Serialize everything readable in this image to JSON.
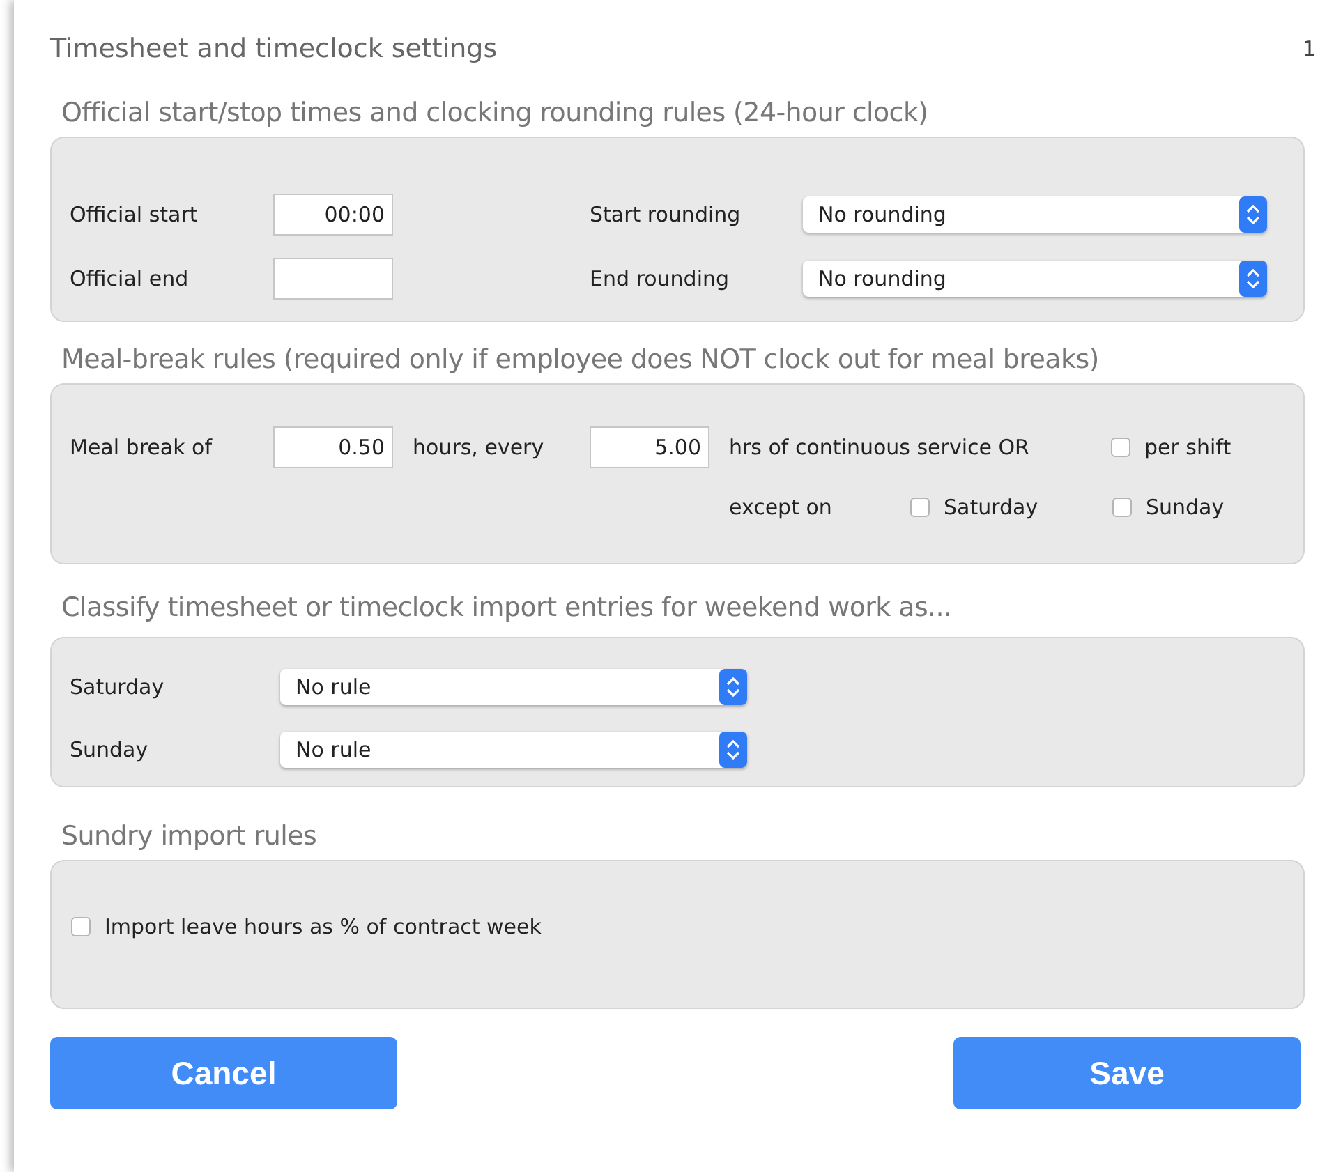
{
  "window": {
    "title": "Timesheet and timeclock settings",
    "page_number": "1"
  },
  "official_times": {
    "heading": "Official start/stop times and clocking rounding rules (24-hour clock)",
    "rows": [
      {
        "label": "Official start",
        "value": "00:00",
        "rounding_label": "Start rounding",
        "rounding_value": "No rounding"
      },
      {
        "label": "Official end",
        "value": "",
        "rounding_label": "End rounding",
        "rounding_value": "No rounding"
      }
    ]
  },
  "meal_break": {
    "heading": "Meal-break rules (required only if employee does NOT clock out for meal breaks)",
    "label": "Meal break of",
    "hours_value": "0.50",
    "hours_label": "hours, every",
    "every_value": "5.00",
    "service_label": "hrs of continuous service OR",
    "per_shift": {
      "label": "per shift",
      "checked": false
    },
    "except_label": "except on",
    "except_days": [
      {
        "label": "Saturday",
        "checked": false
      },
      {
        "label": "Sunday",
        "checked": false
      }
    ]
  },
  "weekend": {
    "heading": "Classify timesheet or timeclock import entries for weekend work as...",
    "rows": [
      {
        "label": "Saturday",
        "value": "No rule"
      },
      {
        "label": "Sunday",
        "value": "No rule"
      }
    ]
  },
  "sundry": {
    "heading": "Sundry import rules",
    "import_leave": {
      "label": "Import leave hours as % of contract week",
      "checked": false
    }
  },
  "buttons": [
    {
      "label": "Cancel"
    },
    {
      "label": "Save"
    }
  ]
}
